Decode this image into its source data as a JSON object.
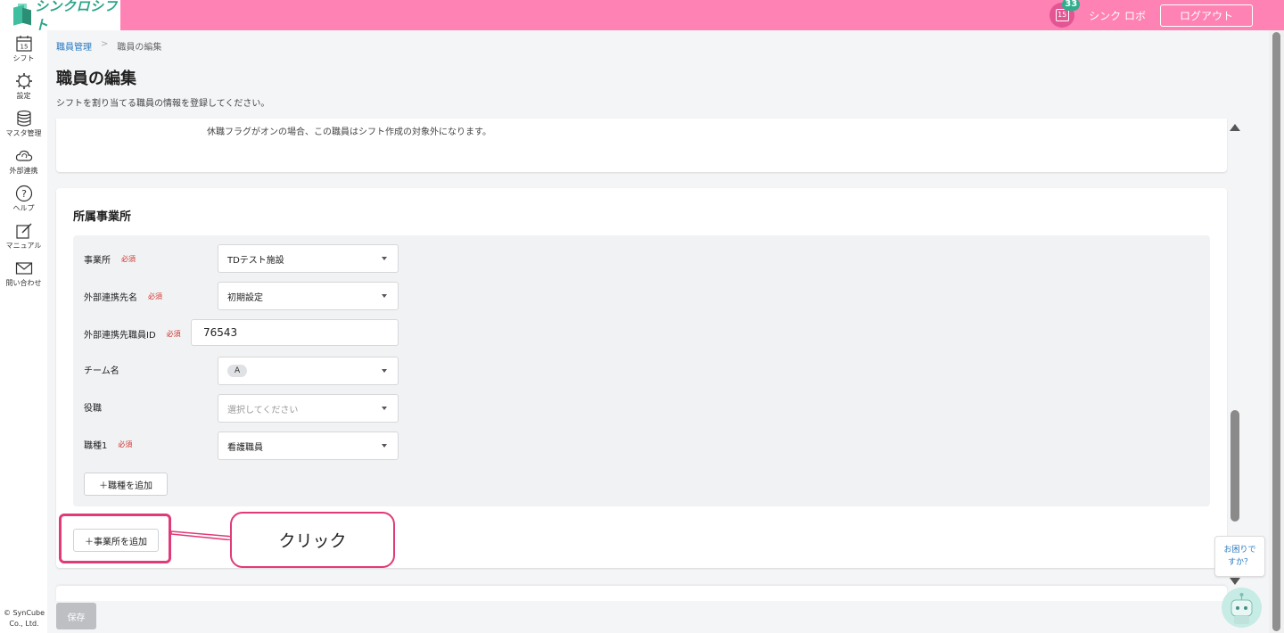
{
  "app": {
    "logo_text": "シンクロシフト",
    "notification_count": "33",
    "calendar_badge_day": "15",
    "user_name": "シンク ロボ",
    "logout_label": "ログアウト"
  },
  "sidebar": {
    "items": [
      {
        "label": "シフト",
        "icon": "calendar-icon"
      },
      {
        "label": "設定",
        "icon": "gear-icon"
      },
      {
        "label": "マスタ管理",
        "icon": "database-icon"
      },
      {
        "label": "外部連携",
        "icon": "cloud-sync-icon"
      },
      {
        "label": "ヘルプ",
        "icon": "help-circle-icon"
      },
      {
        "label": "マニュアル",
        "icon": "edit-note-icon"
      },
      {
        "label": "問い合わせ",
        "icon": "mail-icon"
      }
    ],
    "calendar_day": "15",
    "copyright_line1": "© SynCube",
    "copyright_line2": "Co., Ltd."
  },
  "breadcrumb": {
    "parent": "職員管理",
    "separator": ">",
    "current": "職員の編集"
  },
  "page": {
    "title": "職員の編集",
    "description": "シフトを割り当てる職員の情報を登録してください。",
    "leave_note": "休職フラグがオンの場合、この職員はシフト作成の対象外になります。"
  },
  "affiliation": {
    "section_title": "所属事業所",
    "required_label": "必須",
    "fields": {
      "office": {
        "label": "事業所",
        "value": "TDテスト施設"
      },
      "ext_name": {
        "label": "外部連携先名",
        "value": "初期設定"
      },
      "ext_staff_id": {
        "label": "外部連携先職員ID",
        "value": "76543"
      },
      "team": {
        "label": "チーム名",
        "chip": "A"
      },
      "position": {
        "label": "役職",
        "placeholder": "選択してください"
      },
      "job1": {
        "label": "職種1",
        "value": "看護職員"
      }
    },
    "add_job_label": "＋職種を追加",
    "add_office_label": "＋事業所を追加"
  },
  "annotation": {
    "callout_text": "クリック",
    "color": "#e03a78"
  },
  "footer": {
    "save_label": "保存"
  },
  "help_widget": {
    "line1": "お困りで",
    "line2": "すか？"
  },
  "colors": {
    "header": "#ff82b4",
    "brand_green": "#2aa58a",
    "required": "#d0342c"
  }
}
